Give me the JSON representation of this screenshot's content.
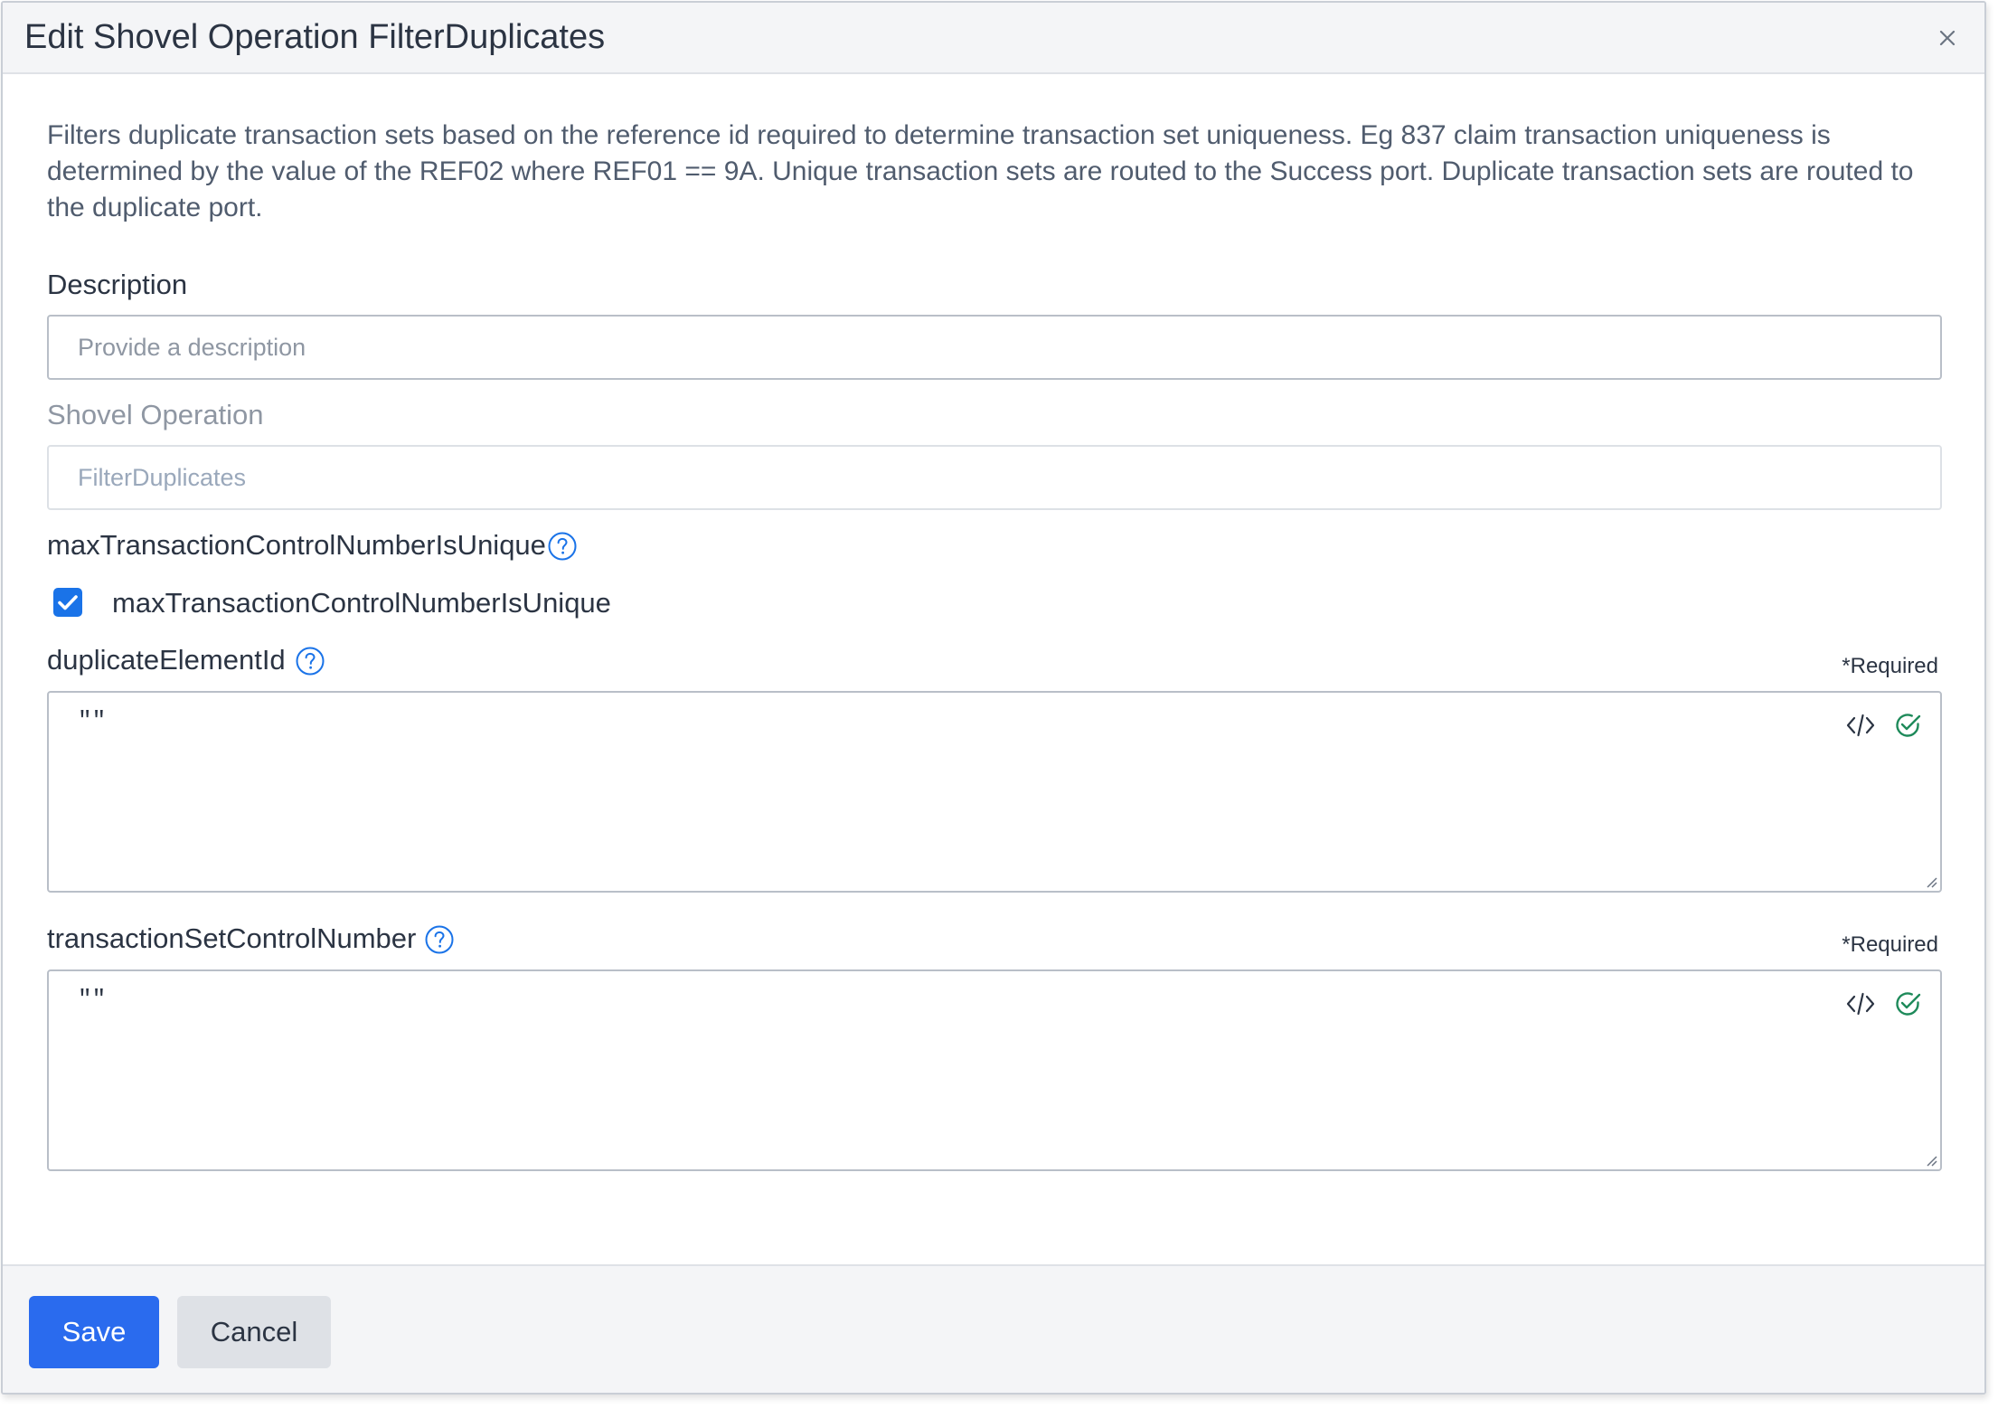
{
  "dialog": {
    "title": "Edit Shovel Operation FilterDuplicates",
    "close_icon": "close-icon"
  },
  "intro_text": "Filters duplicate transaction sets based on the reference id required to determine transaction set uniqueness. Eg 837 claim transaction uniqueness is determined by the value of the REF02 where REF01 == 9A. Unique transaction sets are routed to the Success port. Duplicate transaction sets are routed to the duplicate port.",
  "description": {
    "label": "Description",
    "placeholder": "Provide a description",
    "value": ""
  },
  "shovel_operation": {
    "label": "Shovel Operation",
    "value": "FilterDuplicates"
  },
  "max_unique": {
    "label": "maxTransactionControlNumberIsUnique",
    "checkbox_label": "maxTransactionControlNumberIsUnique",
    "checked": true
  },
  "duplicate_element_id": {
    "label": "duplicateElementId",
    "required": "*Required",
    "value": "\"\""
  },
  "transaction_set_control_number": {
    "label": "transactionSetControlNumber",
    "required": "*Required",
    "value": "\"\""
  },
  "footer": {
    "save_label": "Save",
    "cancel_label": "Cancel"
  },
  "colors": {
    "primary": "#2a6bee",
    "checkbox": "#1a73e8",
    "help_icon": "#1a73e8",
    "valid_check": "#1e8a5a",
    "header_bg": "#f4f5f7"
  }
}
